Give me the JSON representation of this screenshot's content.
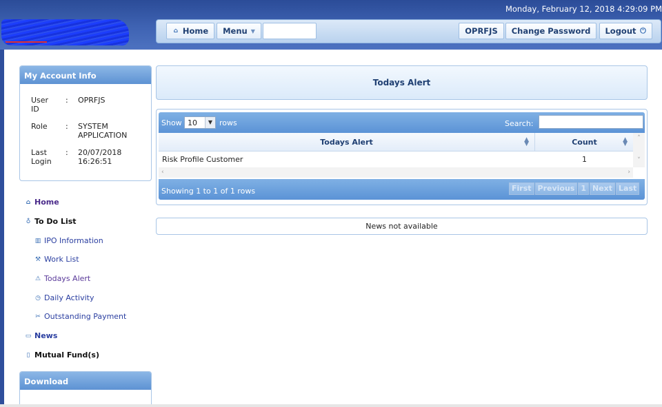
{
  "header": {
    "datetime": "Monday, February 12, 2018 4:29:09 PM",
    "nav": {
      "home": "Home",
      "menu": "Menu",
      "menu_search_value": "",
      "user": "OPRFJS",
      "change_password": "Change Password",
      "logout": "Logout"
    }
  },
  "account": {
    "title": "My Account Info",
    "rows": [
      {
        "key": "User ID",
        "sep": ":",
        "value": "OPRFJS"
      },
      {
        "key": "Role",
        "sep": ":",
        "value": "SYSTEM APPLICATION"
      },
      {
        "key": "Last Login",
        "sep": ":",
        "value": "20/07/2018 16:26:51"
      }
    ]
  },
  "sidebar": {
    "home": "Home",
    "todo": "To Do List",
    "todo_items": [
      "IPO Information",
      "Work List",
      "Todays Alert",
      "Daily Activity",
      "Outstanding Payment"
    ],
    "news": "News",
    "mutual_funds": "Mutual Fund(s)"
  },
  "download": {
    "title": "Download"
  },
  "main": {
    "title": "Todays Alert",
    "table": {
      "show_label": "Show",
      "rows_value": "10",
      "rows_label": "rows",
      "search_label": "Search:",
      "search_value": "",
      "columns": [
        "Todays Alert",
        "Count"
      ],
      "rows": [
        [
          "Risk Profile Customer",
          "1"
        ]
      ],
      "info": "Showing 1 to 1 of 1 rows",
      "pager": [
        "First",
        "Previous",
        "1",
        "Next",
        "Last"
      ]
    },
    "news_text": "News not available"
  }
}
